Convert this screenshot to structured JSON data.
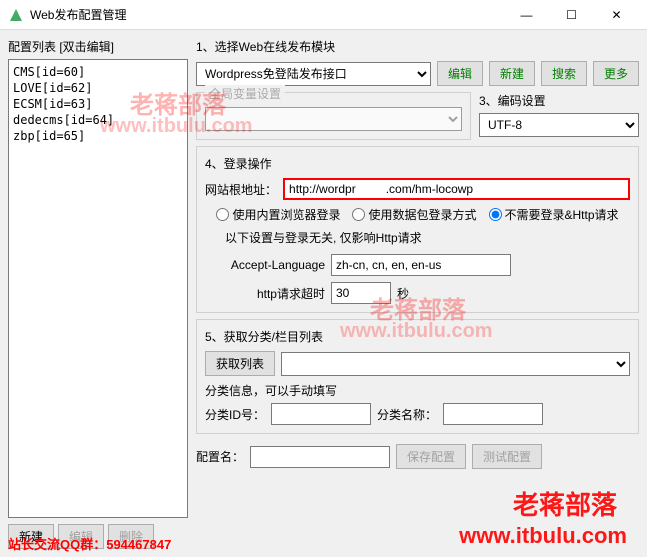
{
  "window": {
    "title": "Web发布配置管理",
    "minimize": "—",
    "maximize": "☐",
    "close": "✕"
  },
  "left": {
    "label": "配置列表  [双击编辑]",
    "items": [
      "CMS[id=60]",
      "LOVE[id=62]",
      "ECSM[id=63]",
      "dedecms[id=64]",
      "zbp[id=65]"
    ],
    "btn_new": "新建",
    "btn_edit": "编辑",
    "btn_delete": "删除"
  },
  "s1": {
    "title": "1、选择Web在线发布模块",
    "module": "Wordpress免登陆发布接口",
    "btn_edit": "编辑",
    "btn_new": "新建",
    "btn_search": "搜索",
    "btn_more": "更多"
  },
  "s2": {
    "global_var_title": "全局变量设置",
    "encoding_title": "3、编码设置",
    "encoding": "UTF-8"
  },
  "s4": {
    "title": "4、登录操作",
    "root_label": "网站根地址：",
    "root_url": "http://wordpr         .com/hm-locowp",
    "radio1": "使用内置浏览器登录",
    "radio2": "使用数据包登录方式",
    "radio3": "不需要登录&Http请求",
    "sub_note": "以下设置与登录无关, 仅影响Http请求",
    "accept_lang_label": "Accept-Language",
    "accept_lang": "zh-cn, cn, en, en-us",
    "timeout_label": "http请求超时",
    "timeout": "30",
    "timeout_unit": "秒"
  },
  "s5": {
    "title": "5、获取分类/栏目列表",
    "btn_get": "获取列表",
    "info_label": "分类信息，可以手动填写",
    "id_label": "分类ID号：",
    "name_label": "分类名称："
  },
  "bottom": {
    "config_name_label": "配置名：",
    "btn_save": "保存配置",
    "btn_test": "测试配置"
  },
  "watermarks": {
    "text1": "老蒋部落",
    "text2": "www.itbulu.com"
  },
  "footer": {
    "qq": "站长交流QQ群：594467847"
  }
}
